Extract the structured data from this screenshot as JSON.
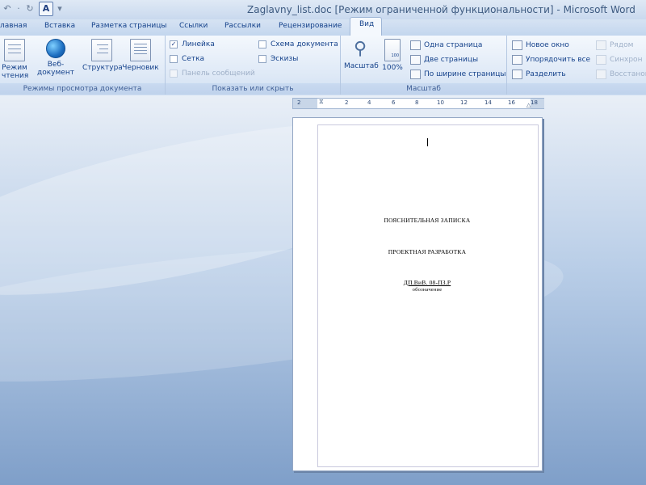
{
  "window": {
    "title": "Zaglavny_list.doc [Режим ограниченной функциональности] - Microsoft Word"
  },
  "quick_access": {
    "undo_icon": "undo-icon",
    "redo_icon": "redo-icon",
    "format_label": "A"
  },
  "tabs": [
    {
      "label": "лавная"
    },
    {
      "label": "Вставка"
    },
    {
      "label": "Разметка страницы"
    },
    {
      "label": "Ссылки"
    },
    {
      "label": "Рассылки"
    },
    {
      "label": "Рецензирование"
    },
    {
      "label": "Вид",
      "active": true
    }
  ],
  "ribbon": {
    "views_group": {
      "label": "Режимы просмотра документа",
      "buttons": [
        {
          "label": "Режим\nчтения",
          "icon": "reading-mode-icon"
        },
        {
          "label": "Веб-документ",
          "icon": "web-document-icon"
        },
        {
          "label": "Структура",
          "icon": "outline-icon"
        },
        {
          "label": "Черновик",
          "icon": "draft-icon"
        }
      ]
    },
    "show_group": {
      "label": "Показать или скрыть",
      "options": [
        {
          "label": "Линейка",
          "checked": true,
          "enabled": true
        },
        {
          "label": "Сетка",
          "checked": false,
          "enabled": true
        },
        {
          "label": "Панель сообщений",
          "checked": false,
          "enabled": false
        },
        {
          "label": "Схема документа",
          "checked": false,
          "enabled": true
        },
        {
          "label": "Эскизы",
          "checked": false,
          "enabled": true
        }
      ]
    },
    "zoom_group": {
      "label": "Масштаб",
      "zoom_button": "Масштаб",
      "percent_button": "100%",
      "options": [
        "Одна страница",
        "Две страницы",
        "По ширине страницы"
      ]
    },
    "window_group": {
      "options": [
        "Новое окно",
        "Упорядочить все",
        "Разделить"
      ],
      "disabled_options": [
        "Рядом",
        "Синхрон",
        "Восстанов"
      ]
    }
  },
  "ruler": {
    "labels": [
      "2",
      "2",
      "4",
      "6",
      "8",
      "10",
      "12",
      "14",
      "16",
      "18"
    ]
  },
  "document": {
    "line1": "ПОЯСНИТЕЛЬНАЯ ЗАПИСКА",
    "line2": "ПРОЕКТНАЯ РАЗРАБОТКА",
    "line3": "ДП.ВиВ. 08-ПЗ.Р",
    "line4": "обозначение"
  },
  "colors": {
    "ribbon_text": "#15428b",
    "background_top": "#e9eff7",
    "background_bottom": "#7f9fc9"
  }
}
